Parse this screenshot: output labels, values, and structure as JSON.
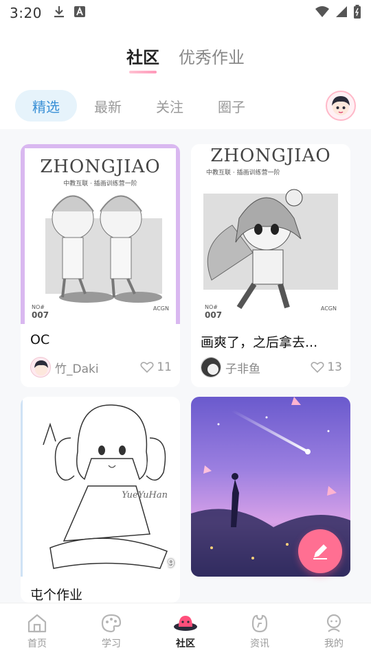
{
  "status": {
    "time": "3:20"
  },
  "top_tabs": [
    {
      "label": "社区",
      "active": true
    },
    {
      "label": "优秀作业",
      "active": false
    }
  ],
  "filters": [
    {
      "label": "精选",
      "active": true
    },
    {
      "label": "最新",
      "active": false
    },
    {
      "label": "关注",
      "active": false
    },
    {
      "label": "圈子",
      "active": false
    }
  ],
  "posts": [
    {
      "title": "OC",
      "author": "竹_Daki",
      "likes": "11",
      "poster_title": "ZHONGJIAO",
      "poster_sub": "中教互联 · 插画训练营一阶",
      "poster_no": "NO#",
      "poster_num": "007",
      "poster_tag": "ACGN"
    },
    {
      "title": "画爽了，之后拿去...",
      "author": "子非鱼",
      "likes": "13",
      "poster_title": "ZHONGJIAO",
      "poster_sub": "中教互联 · 插画训练营一阶",
      "poster_no": "NO#",
      "poster_num": "007",
      "poster_tag": "ACGN"
    },
    {
      "title": "屯个作业",
      "author": "",
      "likes": "",
      "image_count": "9",
      "watermark": "YueYuHan"
    },
    {
      "title": "",
      "author": "",
      "likes": ""
    }
  ],
  "fab": {
    "icon": "pencil-icon",
    "color": "#ff6f92"
  },
  "bottom_nav": [
    {
      "label": "首页",
      "icon": "home-icon",
      "active": false
    },
    {
      "label": "学习",
      "icon": "palette-icon",
      "active": false
    },
    {
      "label": "社区",
      "icon": "community-icon",
      "active": true
    },
    {
      "label": "资讯",
      "icon": "news-icon",
      "active": false
    },
    {
      "label": "我的",
      "icon": "profile-icon",
      "active": false
    }
  ],
  "colors": {
    "accent_blue": "#3a90d6",
    "accent_pink": "#ff6f92",
    "filter_active_bg": "#e6f3fb"
  }
}
